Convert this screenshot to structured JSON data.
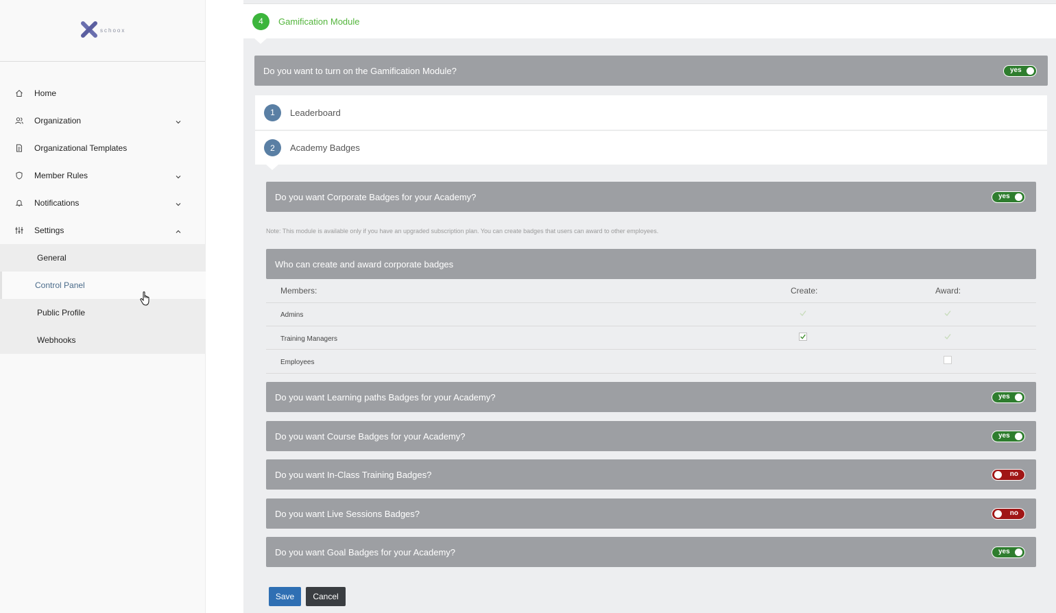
{
  "logo": {
    "wordmark": "schoox"
  },
  "sidebar": {
    "items": [
      {
        "label": "Home",
        "icon": "home-icon"
      },
      {
        "label": "Organization",
        "icon": "users-icon"
      },
      {
        "label": "Organizational Templates",
        "icon": "document-icon"
      },
      {
        "label": "Member Rules",
        "icon": "shield-icon"
      },
      {
        "label": "Notifications",
        "icon": "bell-icon"
      },
      {
        "label": "Settings",
        "icon": "sliders-icon"
      }
    ],
    "settings_sub": [
      "General",
      "Control Panel",
      "Public Profile",
      "Webhooks"
    ],
    "active_sub": "Control Panel"
  },
  "step4": {
    "number": "4",
    "title": "Gamification Module"
  },
  "gamification_toggle": {
    "question": "Do you want to turn on the Gamification Module?",
    "state": "yes"
  },
  "steps": [
    {
      "number": "1",
      "title": "Leaderboard"
    },
    {
      "number": "2",
      "title": "Academy Badges"
    }
  ],
  "corporate": {
    "question": "Do you want Corporate Badges for your Academy?",
    "state": "yes"
  },
  "note": "Note: This module is available only if you have an upgraded subscription plan. You can create badges that users can award to other employees.",
  "who": {
    "title": "Who can create and award corporate badges"
  },
  "table": {
    "headers": [
      "Members:",
      "Create:",
      "Award:"
    ],
    "rows": [
      {
        "name": "Admins",
        "create": "checked-disabled",
        "award": "checked-disabled"
      },
      {
        "name": "Training Managers",
        "create": "checked",
        "award": "checked-disabled"
      },
      {
        "name": "Employees",
        "create": "none",
        "award": "unchecked"
      }
    ]
  },
  "badges": [
    {
      "question": "Do you want Learning paths Badges for your Academy?",
      "state": "yes"
    },
    {
      "question": "Do you want Course Badges for your Academy?",
      "state": "yes"
    },
    {
      "question": "Do you want In-Class Training Badges?",
      "state": "no"
    },
    {
      "question": "Do you want Live Sessions Badges?",
      "state": "no"
    },
    {
      "question": "Do you want Goal Badges for your Academy?",
      "state": "yes"
    }
  ],
  "buttons": {
    "save": "Save",
    "cancel": "Cancel"
  },
  "colors": {
    "accent_green": "#3cb53c",
    "bar_gray": "#9d9fa3",
    "toggle_on": "#2e7d2e",
    "toggle_off": "#a01616",
    "save_blue": "#2f6fb3"
  }
}
